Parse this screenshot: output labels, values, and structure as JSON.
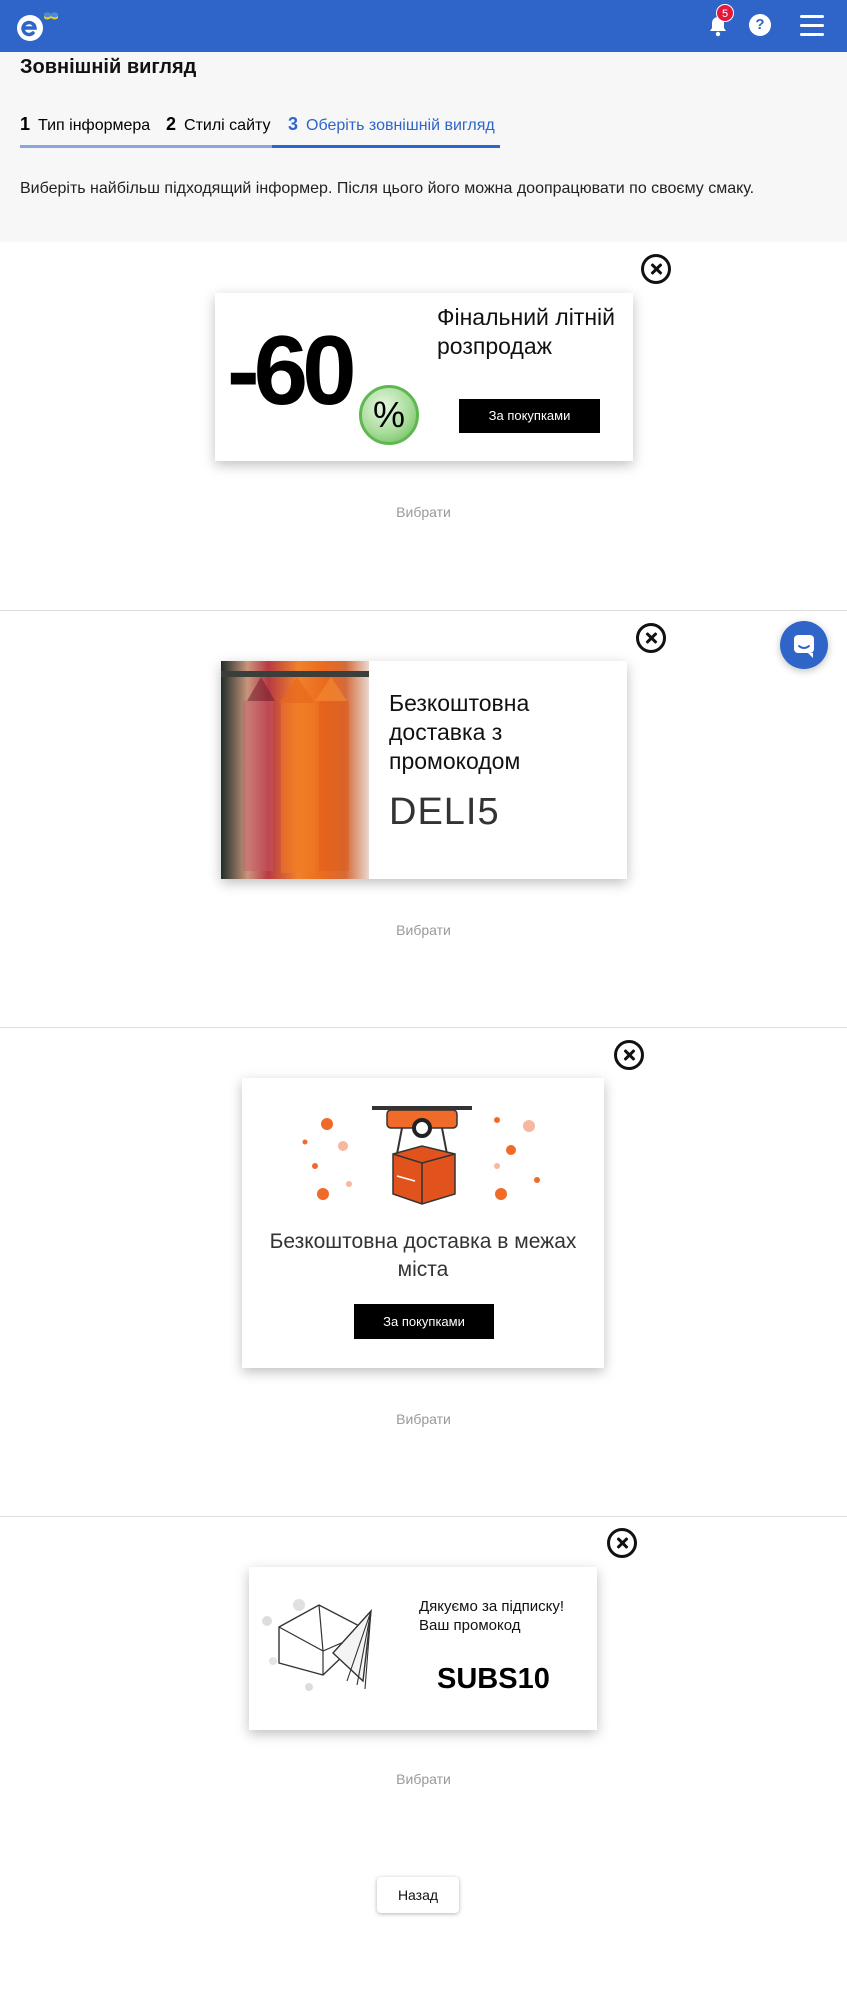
{
  "topbar": {
    "notification_count": "5",
    "help_label": "?"
  },
  "header": {
    "title": "Зовнішній вигляд",
    "steps": [
      {
        "num": "1",
        "label": "Тип інформера"
      },
      {
        "num": "2",
        "label": "Стилі сайту"
      },
      {
        "num": "3",
        "label": "Оберіть зовнішній вигляд"
      }
    ],
    "instruction": "Виберіть найбільш підходящий інформер. Після цього його можна доопрацювати по своєму смаку."
  },
  "informers": [
    {
      "big_text": "-60",
      "percent": "%",
      "headline": "Фінальний літній розпродаж",
      "button": "За покупками",
      "select": "Вибрати"
    },
    {
      "headline": "Безкоштовна доставка з промокодом",
      "code": "DELI5",
      "select": "Вибрати"
    },
    {
      "headline": "Безкоштовна доставка в межах міста",
      "button": "За покупками",
      "select": "Вибрати"
    },
    {
      "headline": "Дякуємо за підписку! Ваш промокод",
      "code": "SUBS10",
      "select": "Вибрати"
    }
  ],
  "footer": {
    "back_label": "Назад"
  },
  "icons": {
    "logo": "brand-logo-icon",
    "bell": "bell-icon",
    "help": "help-icon",
    "menu": "hamburger-menu-icon",
    "close": "close-icon",
    "chat": "chat-icon"
  },
  "colors": {
    "brand_blue": "#2f65c9",
    "badge_red": "#e5173a",
    "drone_orange": "#f06a2a"
  }
}
